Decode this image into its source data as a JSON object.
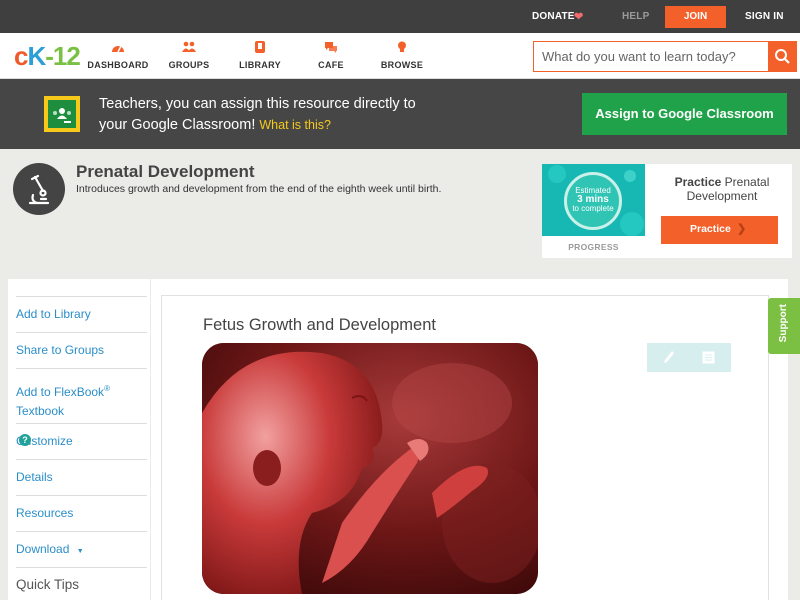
{
  "topbar": {
    "donate": "DONATE",
    "help": "HELP",
    "join": "JOIN",
    "signin": "SIGN IN"
  },
  "nav": {
    "logo": {
      "c": "c",
      "k": "K",
      "dash": "-",
      "num": "12"
    },
    "items": [
      {
        "label": "DASHBOARD",
        "icon": "dashboard-icon"
      },
      {
        "label": "GROUPS",
        "icon": "groups-icon"
      },
      {
        "label": "LIBRARY",
        "icon": "library-icon"
      },
      {
        "label": "CAFE",
        "icon": "cafe-icon"
      },
      {
        "label": "BROWSE",
        "icon": "browse-icon"
      }
    ],
    "search_placeholder": "What do you want to learn today?"
  },
  "banner": {
    "line1": "Teachers, you can assign this resource directly to",
    "line2": "your Google Classroom!",
    "link": "What is this?",
    "button": "Assign to Google Classroom"
  },
  "header": {
    "title": "Prenatal Development",
    "description": "Introduces growth and development from the end of the eighth week until birth."
  },
  "practice": {
    "estimated": "Estimated",
    "mins": "3 mins",
    "to_complete": "to complete",
    "progress_label": "PROGRESS",
    "title_bold": "Practice",
    "title_rest": "Prenatal Development",
    "button": "Practice"
  },
  "sidebar": {
    "add_library": "Add to Library",
    "share_groups": "Share to Groups",
    "add_flexbook_1": "Add to FlexBook",
    "add_flexbook_reg": "®",
    "add_flexbook_2": "Textbook",
    "customize": "Customize",
    "customize_help": "?",
    "details": "Details",
    "resources": "Resources",
    "download": "Download",
    "download_caret": "▼",
    "quick_tips": "Quick Tips"
  },
  "article": {
    "title": "Fetus Growth and Development"
  },
  "support": "Support",
  "colors": {
    "accent": "#f3602a",
    "green": "#20a24a",
    "link": "#2b8ec8",
    "teal": "#17b8b4"
  }
}
